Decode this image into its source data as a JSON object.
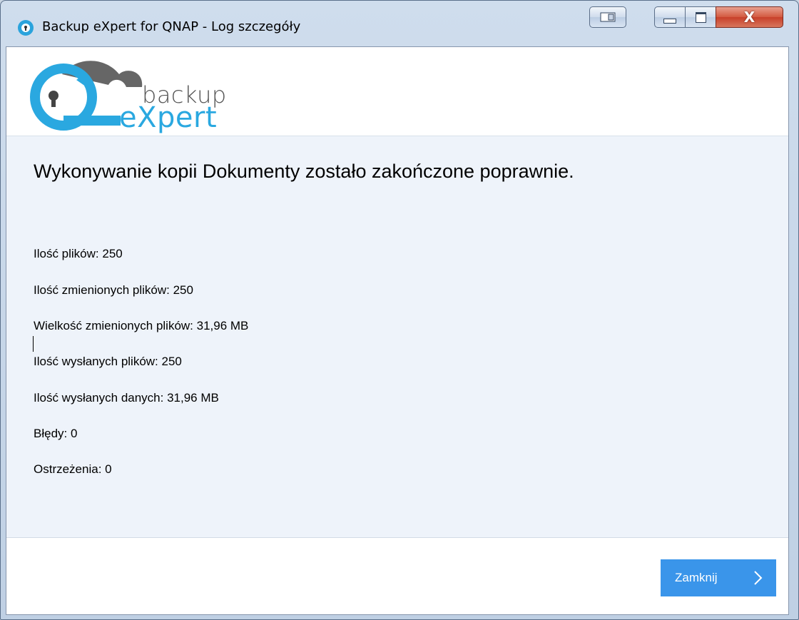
{
  "window": {
    "title": "Backup eXpert for QNAP - Log szczegóły",
    "close_glyph": "X"
  },
  "logo": {
    "line1": "backup",
    "line2": "eXpert"
  },
  "report": {
    "headline": "Wykonywanie kopii Dokumenty zostało zakończone poprawnie.",
    "stats": [
      "Ilość plików:  250",
      "Ilość zmienionych plików: 250",
      "Wielkość zmienionych plików: 31,96 MB",
      "Ilość wysłanych plików: 250",
      "Ilość wysłanych danych: 31,96 MB",
      "Błędy: 0",
      "Ostrzeżenia: 0"
    ]
  },
  "footer": {
    "close_label": "Zamknij"
  },
  "colors": {
    "accent": "#3a95ea",
    "logo_blue": "#2aa8e0",
    "content_bg": "#eef3fa"
  },
  "icons": {
    "app": "backup-expert-app-icon",
    "snap": "snap-window-icon",
    "minimize": "minimize-icon",
    "maximize": "maximize-icon",
    "close": "close-icon",
    "chevron": "chevron-right-icon"
  }
}
